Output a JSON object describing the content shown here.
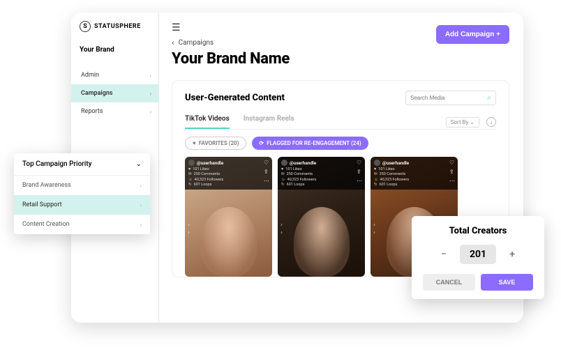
{
  "logo": {
    "glyph": "S",
    "text": "STATUSPHERE"
  },
  "sidebar": {
    "brand_label": "Your Brand",
    "items": [
      {
        "label": "Admin"
      },
      {
        "label": "Campaigns",
        "active": true
      },
      {
        "label": "Reports"
      }
    ]
  },
  "header": {
    "breadcrumb": "Campaigns",
    "title": "Your Brand Name",
    "add_btn": "Add Campaign  +"
  },
  "panel": {
    "title": "User-Generated Content",
    "search_placeholder": "Search Media",
    "tabs": [
      {
        "label": "TikTok Videos",
        "active": true
      },
      {
        "label": "Instagram Reels"
      }
    ],
    "sort_label": "Sort By",
    "chips": {
      "favorites": "FAVORITES (20)",
      "flagged": "FLAGGED FOR RE-ENGAGEMENT (24)"
    }
  },
  "media": [
    {
      "handle": "@userhandle",
      "stats": [
        "101 Likes",
        "250 Comments",
        "40,323 Followers",
        "601 Loops"
      ]
    },
    {
      "handle": "@userhandle",
      "stats": [
        "101 Likes",
        "250 Comments",
        "40,323 Followers",
        "601 Loops"
      ]
    },
    {
      "handle": "@userhandle",
      "stats": [
        "101 Likes",
        "250 Comments",
        "40,323 Followers",
        "601 Loops"
      ]
    }
  ],
  "dropdown": {
    "head": "Top Campaign Priority",
    "items": [
      {
        "label": "Brand Awareness"
      },
      {
        "label": "Retail Support",
        "selected": true
      },
      {
        "label": "Content Creation"
      }
    ]
  },
  "creators": {
    "title": "Total Creators",
    "value": "201",
    "cancel": "CANCEL",
    "save": "SAVE"
  }
}
